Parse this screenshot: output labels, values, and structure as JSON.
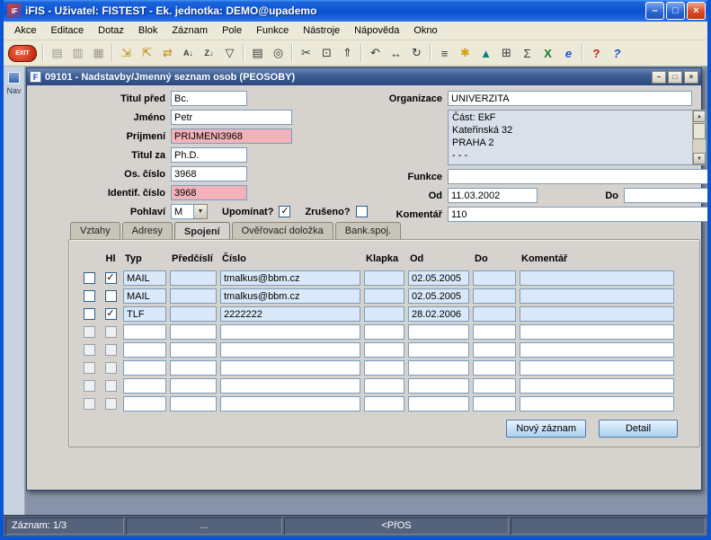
{
  "window": {
    "title": "iFIS - Uživatel: FISTEST - Ek. jednotka: DEMO@upademo",
    "app_icon": "iF",
    "controls": {
      "minimize": "–",
      "maximize": "□",
      "close": "×"
    }
  },
  "menu": {
    "items": [
      "Akce",
      "Editace",
      "Dotaz",
      "Blok",
      "Záznam",
      "Pole",
      "Funkce",
      "Nástroje",
      "Nápověda",
      "Okno"
    ]
  },
  "toolbar": {
    "icons": [
      {
        "name": "exit-icon",
        "glyph": "EXIT",
        "style": "exit"
      },
      {
        "separator": true
      },
      {
        "name": "save-icon",
        "glyph": "▤",
        "style": "dim"
      },
      {
        "name": "print-screen-icon",
        "glyph": "▥",
        "style": "dim"
      },
      {
        "name": "clear-record-icon",
        "glyph": "▦",
        "style": "dim"
      },
      {
        "separator": true
      },
      {
        "name": "enter-query-icon",
        "glyph": "⇲",
        "style": "yellow"
      },
      {
        "name": "execute-query-icon",
        "glyph": "⇱",
        "style": "yellow"
      },
      {
        "name": "cancel-query-icon",
        "glyph": "⇄",
        "style": "yellow"
      },
      {
        "name": "sort-asc-icon",
        "glyph": "A↓",
        "style": "small"
      },
      {
        "name": "sort-desc-icon",
        "glyph": "Z↓",
        "style": "small"
      },
      {
        "name": "filter-icon",
        "glyph": "▽"
      },
      {
        "separator": true
      },
      {
        "name": "print-icon",
        "glyph": "▤"
      },
      {
        "name": "preview-icon",
        "glyph": "◎"
      },
      {
        "separator": true
      },
      {
        "name": "cut-icon",
        "glyph": "✂"
      },
      {
        "name": "copy-icon",
        "glyph": "⊡"
      },
      {
        "name": "paste-icon",
        "glyph": "⇑"
      },
      {
        "separator": true
      },
      {
        "name": "undo-icon",
        "glyph": "↶"
      },
      {
        "name": "navigate-icon",
        "glyph": "↔"
      },
      {
        "name": "refresh-icon",
        "glyph": "↻"
      },
      {
        "separator": true
      },
      {
        "name": "list-values-icon",
        "glyph": "≡"
      },
      {
        "name": "wizard-icon",
        "glyph": "✱",
        "style": "gold"
      },
      {
        "name": "chart-icon",
        "glyph": "▲",
        "style": "teal"
      },
      {
        "name": "calculator-icon",
        "glyph": "⊞"
      },
      {
        "name": "sum-icon",
        "glyph": "Σ"
      },
      {
        "name": "excel-icon",
        "glyph": "X",
        "style": "green"
      },
      {
        "name": "web-icon",
        "glyph": "e",
        "style": "blue"
      },
      {
        "separator": true
      },
      {
        "name": "help-doc-icon",
        "glyph": "?",
        "style": "red"
      },
      {
        "name": "help-icon",
        "glyph": "?",
        "style": "blue"
      }
    ]
  },
  "nav": {
    "label": "Nav"
  },
  "form_window": {
    "title": "09101 - Nadstavby/Jmenný seznam osob (PEOSOBY)",
    "icon": "F",
    "controls": {
      "minimize": "–",
      "restore": "□",
      "close": "×"
    }
  },
  "fields": {
    "titul_pred": {
      "label": "Titul před",
      "value": "Bc."
    },
    "jmeno": {
      "label": "Jméno",
      "value": "Petr"
    },
    "prijmeni": {
      "label": "Prijmení",
      "value": "PRIJMENI3968"
    },
    "titul_za": {
      "label": "Titul za",
      "value": "Ph.D."
    },
    "os_cislo": {
      "label": "Os. číslo",
      "value": "3968"
    },
    "identif_cislo": {
      "label": "Identif. číslo",
      "value": "3968"
    },
    "pohlavi": {
      "label": "Pohlaví",
      "value": "M"
    },
    "upominat": {
      "label": "Upomínat?",
      "checked": true
    },
    "zruseno": {
      "label": "Zrušeno?",
      "checked": false
    },
    "organizace": {
      "label": "Organizace",
      "value": "UNIVERZITA"
    },
    "org_detail": {
      "lines": [
        "Část: EkF",
        "Kateřinská 32",
        "PRAHA 2",
        "- - -"
      ]
    },
    "funkce": {
      "label": "Funkce",
      "value": ""
    },
    "od": {
      "label": "Od",
      "value": "11.03.2002"
    },
    "do": {
      "label": "Do",
      "value": ""
    },
    "komentar": {
      "label": "Komentář",
      "value": "110"
    }
  },
  "tabs": {
    "items": [
      "Vztahy",
      "Adresy",
      "Spojení",
      "Ověřovací doložka",
      "Bank.spoj."
    ],
    "active": "Spojení"
  },
  "table": {
    "headers": [
      "Hl",
      "Typ",
      "Předčíslí",
      "Číslo",
      "Klapka",
      "Od",
      "Do",
      "Komentář"
    ],
    "rows": [
      {
        "selected": false,
        "hl": true,
        "filled": true,
        "cells": [
          "MAIL",
          "",
          "tmalkus@bbm.cz",
          "",
          "02.05.2005",
          "",
          ""
        ]
      },
      {
        "selected": false,
        "hl": false,
        "filled": true,
        "cells": [
          "MAIL",
          "",
          "tmalkus@bbm.cz",
          "",
          "02.05.2005",
          "",
          ""
        ]
      },
      {
        "selected": false,
        "hl": true,
        "filled": true,
        "cells": [
          "TLF",
          "",
          "2222222",
          "",
          "28.02.2006",
          "",
          ""
        ]
      },
      {
        "selected": false,
        "hl": false,
        "filled": false,
        "cells": [
          "",
          "",
          "",
          "",
          "",
          "",
          ""
        ]
      },
      {
        "selected": false,
        "hl": false,
        "filled": false,
        "cells": [
          "",
          "",
          "",
          "",
          "",
          "",
          ""
        ]
      },
      {
        "selected": false,
        "hl": false,
        "filled": false,
        "cells": [
          "",
          "",
          "",
          "",
          "",
          "",
          ""
        ]
      },
      {
        "selected": false,
        "hl": false,
        "filled": false,
        "cells": [
          "",
          "",
          "",
          "",
          "",
          "",
          ""
        ]
      },
      {
        "selected": false,
        "hl": false,
        "filled": false,
        "cells": [
          "",
          "",
          "",
          "",
          "",
          "",
          ""
        ]
      }
    ]
  },
  "buttons": {
    "new_record": "Nový záznam",
    "detail": "Detail"
  },
  "statusbar": {
    "record": "Záznam: 1/3",
    "middle": "...",
    "context": "<PřOS"
  }
}
